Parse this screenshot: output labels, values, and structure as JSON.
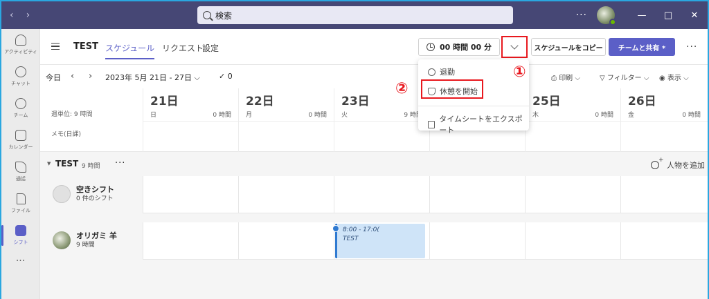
{
  "titlebar": {
    "search_placeholder": "検索",
    "more": "···"
  },
  "rail": [
    {
      "name": "rail-activity",
      "label": "アクティビティ"
    },
    {
      "name": "rail-chat",
      "label": "チャット"
    },
    {
      "name": "rail-teams",
      "label": "チーム"
    },
    {
      "name": "rail-calendar",
      "label": "カレンダー"
    },
    {
      "name": "rail-calls",
      "label": "通話"
    },
    {
      "name": "rail-files",
      "label": "ファイル"
    },
    {
      "name": "rail-shifts",
      "label": "シフト"
    }
  ],
  "header": {
    "team": "TEST",
    "tabs": [
      "スケジュール",
      "リクエスト",
      "設定"
    ],
    "clock": "00 時間 00 分",
    "copy": "スケジュールをコピー",
    "share": "チームと共有 *",
    "more": "···"
  },
  "toolbar": {
    "today": "今日",
    "range": "2023年 5月 21日 - 27日",
    "count": "0",
    "print": "印刷",
    "filter": "フィルター",
    "view": "表示"
  },
  "grid": {
    "week_label": "週単位: 9 時間",
    "memo_label": "メモ(日課)",
    "days": [
      {
        "num": "21日",
        "wk": "日",
        "hrs": "0 時間"
      },
      {
        "num": "22日",
        "wk": "月",
        "hrs": "0 時間"
      },
      {
        "num": "23日",
        "wk": "火",
        "hrs": "9 時間"
      },
      {
        "num": "",
        "wk": "",
        "hrs": ""
      },
      {
        "num": "25日",
        "wk": "木",
        "hrs": "0 時間"
      },
      {
        "num": "26日",
        "wk": "金",
        "hrs": "0 時間"
      }
    ]
  },
  "group": {
    "name": "TEST",
    "hours": "9 時間",
    "more": "···",
    "add_person": "人物を追加"
  },
  "members": [
    {
      "name": "空きシフト",
      "sub": "0 件のシフト"
    },
    {
      "name": "オリガミ 羊",
      "sub": "9 時間"
    }
  ],
  "shift": {
    "time": "8:00 - 17:0(",
    "team": "TEST"
  },
  "dropdown": {
    "clock_out": "退勤",
    "start_break": "休憩を開始",
    "export": "タイムシートをエクスポート"
  },
  "annotations": {
    "one": "①",
    "two": "②"
  },
  "colors": {
    "brand": "#5b5fc7",
    "titlebar": "#464775",
    "highlight": "#e8181e"
  }
}
